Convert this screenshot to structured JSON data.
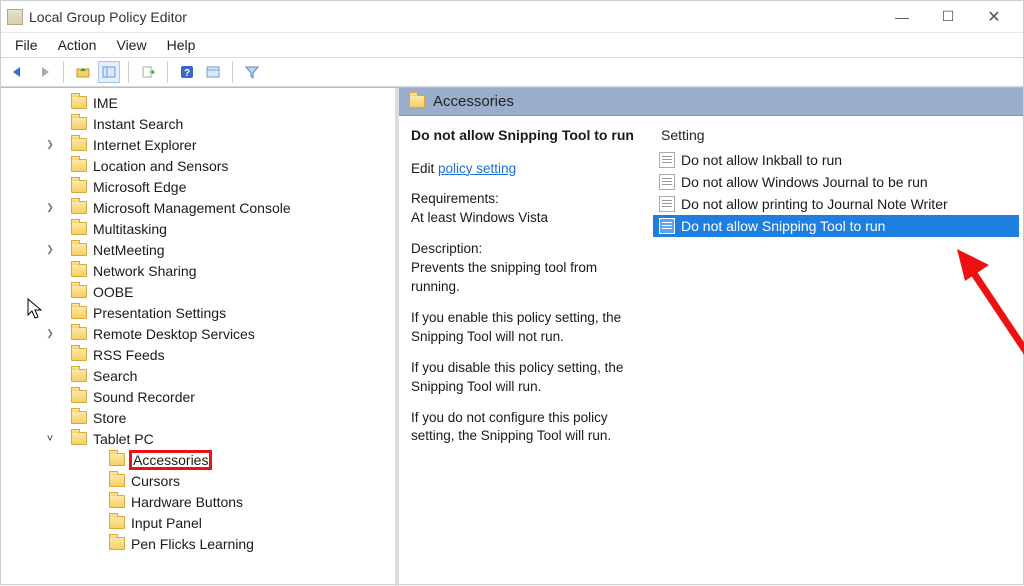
{
  "window": {
    "title": "Local Group Policy Editor"
  },
  "menu": [
    "File",
    "Action",
    "View",
    "Help"
  ],
  "tree": [
    {
      "label": "IME",
      "expander": "",
      "child": false
    },
    {
      "label": "Instant Search",
      "expander": "",
      "child": false
    },
    {
      "label": "Internet Explorer",
      "expander": ">",
      "child": false
    },
    {
      "label": "Location and Sensors",
      "expander": "",
      "child": false
    },
    {
      "label": "Microsoft Edge",
      "expander": "",
      "child": false
    },
    {
      "label": "Microsoft Management Console",
      "expander": ">",
      "child": false
    },
    {
      "label": "Multitasking",
      "expander": "",
      "child": false
    },
    {
      "label": "NetMeeting",
      "expander": ">",
      "child": false
    },
    {
      "label": "Network Sharing",
      "expander": "",
      "child": false
    },
    {
      "label": "OOBE",
      "expander": "",
      "child": false
    },
    {
      "label": "Presentation Settings",
      "expander": "",
      "child": false
    },
    {
      "label": "Remote Desktop Services",
      "expander": ">",
      "child": false
    },
    {
      "label": "RSS Feeds",
      "expander": "",
      "child": false
    },
    {
      "label": "Search",
      "expander": "",
      "child": false
    },
    {
      "label": "Sound Recorder",
      "expander": "",
      "child": false
    },
    {
      "label": "Store",
      "expander": "",
      "child": false
    },
    {
      "label": "Tablet PC",
      "expander": "v",
      "child": false
    },
    {
      "label": "Accessories",
      "expander": "",
      "child": true,
      "highlight": true
    },
    {
      "label": "Cursors",
      "expander": "",
      "child": true
    },
    {
      "label": "Hardware Buttons",
      "expander": "",
      "child": true
    },
    {
      "label": "Input Panel",
      "expander": "",
      "child": true
    },
    {
      "label": "Pen Flicks Learning",
      "expander": "",
      "child": true
    }
  ],
  "crumb": "Accessories",
  "detail": {
    "heading": "Do not allow Snipping Tool to run",
    "edit_prefix": "Edit",
    "edit_link": "policy setting",
    "req_label": "Requirements:",
    "req_value": "At least Windows Vista",
    "desc_label": "Description:",
    "desc_1": "Prevents the snipping tool from running.",
    "desc_2": "If you enable this policy setting, the Snipping Tool will not run.",
    "desc_3": "If you disable this policy setting, the Snipping Tool will run.",
    "desc_4": "If you do not configure this policy setting, the Snipping Tool will run."
  },
  "settings": {
    "col_header": "Setting",
    "rows": [
      {
        "label": "Do not allow Inkball to run",
        "selected": false
      },
      {
        "label": "Do not allow Windows Journal to be run",
        "selected": false
      },
      {
        "label": "Do not allow printing to Journal Note Writer",
        "selected": false
      },
      {
        "label": "Do not allow Snipping Tool to run",
        "selected": true
      }
    ]
  }
}
